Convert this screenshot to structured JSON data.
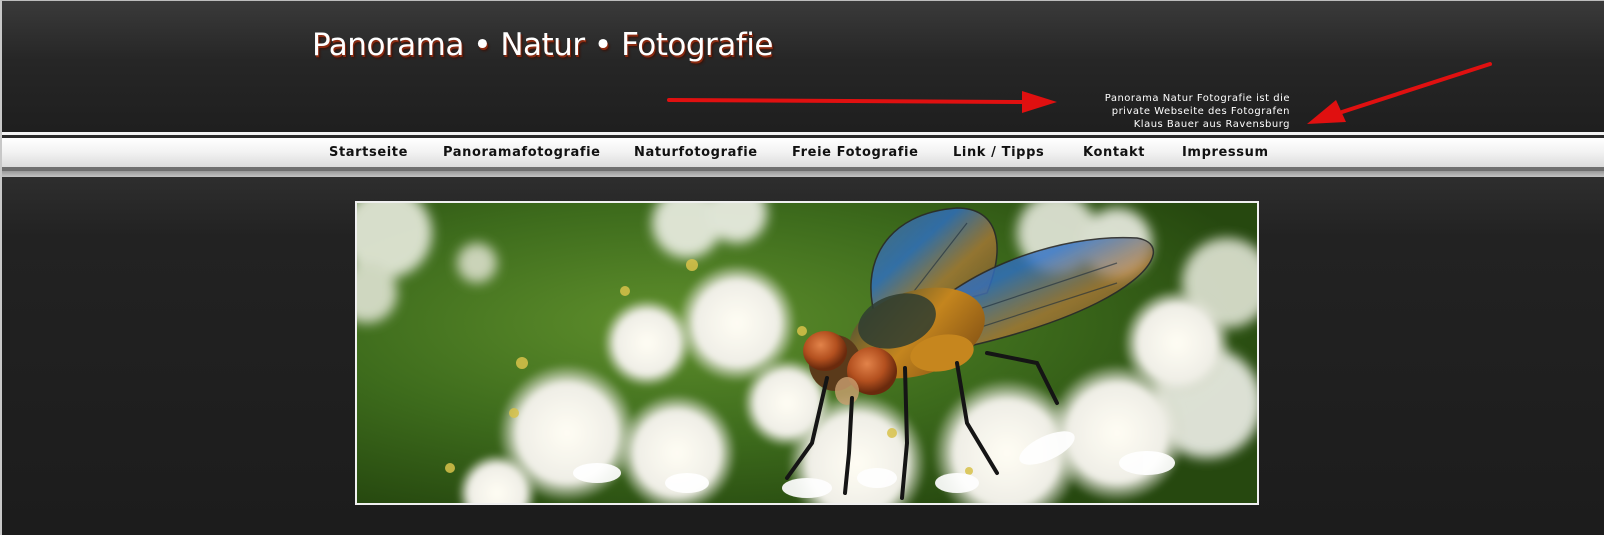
{
  "header": {
    "site_title": "Panorama • Natur • Fotografie",
    "tagline": [
      "Panorama Natur Fotografie ist die",
      "private Webseite des Fotografen",
      "Klaus Bauer aus Ravensburg"
    ]
  },
  "nav": {
    "items": [
      {
        "label": "Startseite"
      },
      {
        "label": "Panoramafotografie"
      },
      {
        "label": "Naturfotografie"
      },
      {
        "label": "Freie Fotografie"
      },
      {
        "label": "Link / Tipps"
      },
      {
        "label": "Kontakt"
      },
      {
        "label": "Impressum"
      }
    ]
  },
  "colors": {
    "annotation_arrow": "#e01010",
    "title_shadow": "#8a2a10"
  },
  "hero": {
    "icon": "fly-on-flowers-photo"
  }
}
